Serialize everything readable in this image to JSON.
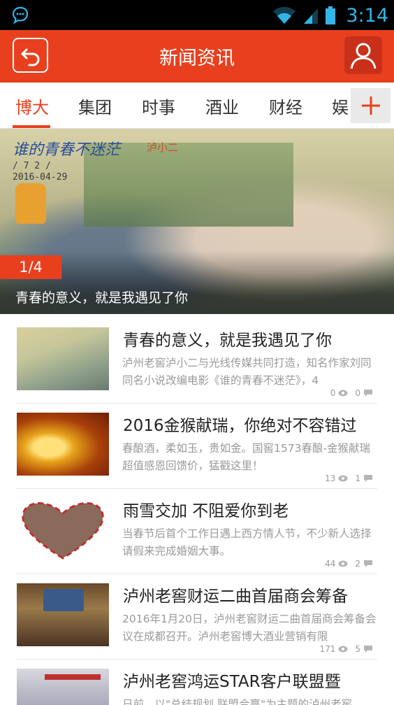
{
  "status_bar": {
    "time": "3:14"
  },
  "app_bar": {
    "title": "新闻资讯"
  },
  "tabs": [
    {
      "label": "博大",
      "active": true
    },
    {
      "label": "集团"
    },
    {
      "label": "时事"
    },
    {
      "label": "酒业"
    },
    {
      "label": "财经"
    },
    {
      "label": "娱"
    }
  ],
  "banner": {
    "slogan": "谁的青春不迷茫",
    "slogan_sub": "泸小二",
    "date_line1": "/ 7 2 /",
    "date_line2": "2016-04-29",
    "counter": "1/4",
    "caption": "青春的意义，就是我遇见了你"
  },
  "news": [
    {
      "title": "青春的意义，就是我遇见了你",
      "summary": "泸州老窖泸小二与光线传媒共同打造，知名作家刘同同名小说改编电影《谁的青春不迷茫》，4",
      "views": "0",
      "comments": "0"
    },
    {
      "title": "2016金猴献瑞，你绝对不容错过",
      "summary": "春酿酒，柔如玉，贵如金。国窖1573春酿-金猴献瑞超值感恩回馈价，猛戳这里！",
      "views": "13",
      "comments": "1"
    },
    {
      "title": "雨雪交加 不阻爱你到老",
      "summary": "当春节后首个工作日遇上西方情人节，不少新人选择请假来完成婚姻大事。",
      "views": "44",
      "comments": "2"
    },
    {
      "title": "泸州老窖财运二曲首届商会筹备",
      "summary": "2016年1月20日，泸州老窖财运二曲首届商会筹备会议在成都召开。泸州老窖博大酒业营销有限",
      "views": "171",
      "comments": "5"
    },
    {
      "title": "泸州老窖鸿运STAR客户联盟暨",
      "summary": "日前，以\"总结规划 联盟合赢\"为主题的泸州老窖",
      "views": "",
      "comments": ""
    }
  ],
  "colors": {
    "accent": "#e8401f",
    "status_blue": "#33b5e5"
  }
}
